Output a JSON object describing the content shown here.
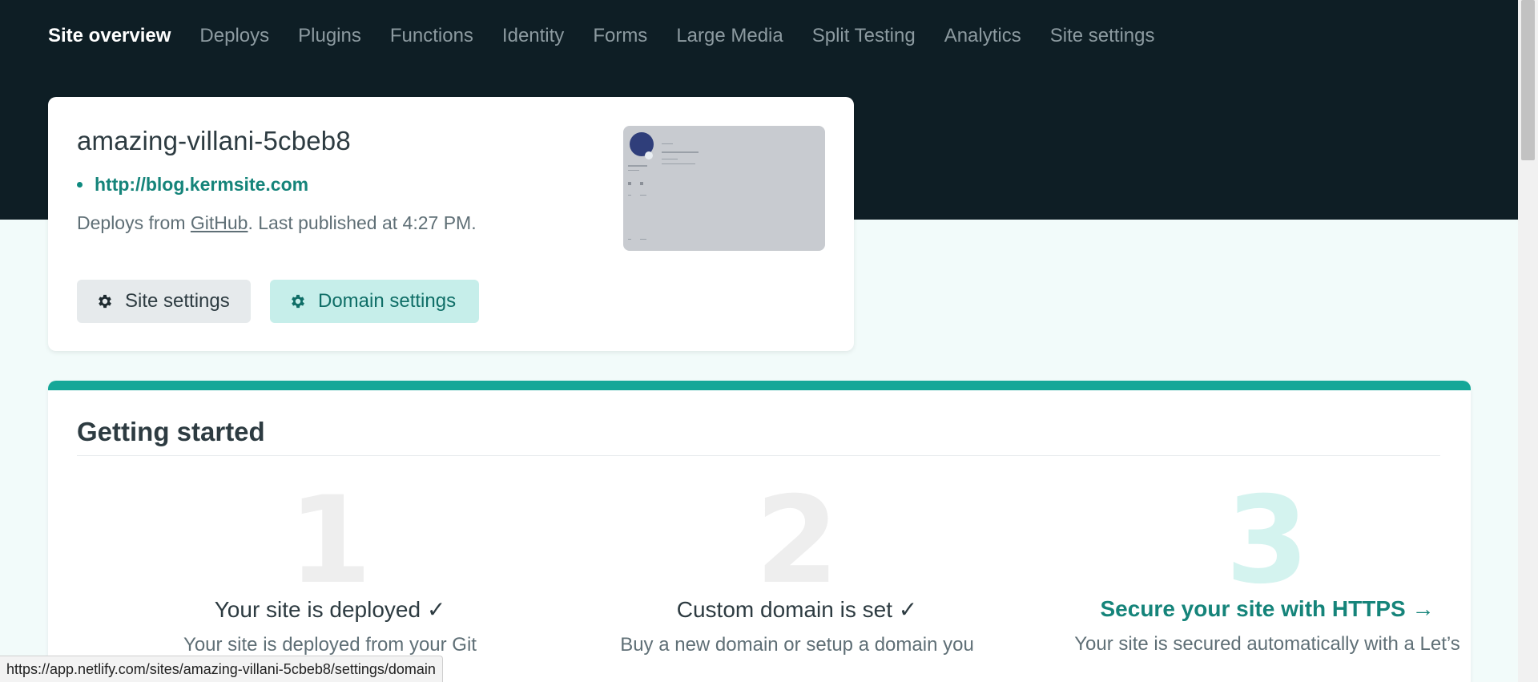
{
  "nav": {
    "items": [
      {
        "label": "Site overview",
        "active": true
      },
      {
        "label": "Deploys"
      },
      {
        "label": "Plugins"
      },
      {
        "label": "Functions"
      },
      {
        "label": "Identity"
      },
      {
        "label": "Forms"
      },
      {
        "label": "Large Media"
      },
      {
        "label": "Split Testing"
      },
      {
        "label": "Analytics"
      },
      {
        "label": "Site settings"
      }
    ]
  },
  "site": {
    "name": "amazing-villani-5cbeb8",
    "url": "http://blog.kermsite.com",
    "deploy_prefix": "Deploys from ",
    "deploy_provider": "GitHub",
    "deploy_suffix": ". Last published at 4:27 PM.",
    "buttons": {
      "site_settings": "Site settings",
      "domain_settings": "Domain settings"
    }
  },
  "getting_started": {
    "title": "Getting started",
    "steps": [
      {
        "number": "1",
        "heading": "Your site is deployed ✓",
        "desc": "Your site is deployed from your Git"
      },
      {
        "number": "2",
        "heading": "Custom domain is set ✓",
        "desc": "Buy a new domain or setup a domain you"
      },
      {
        "number": "3",
        "heading": "Secure your site with HTTPS →",
        "desc": "Your site is secured automatically with a Let’s"
      }
    ]
  },
  "status_bar": {
    "url": "https://app.netlify.com/sites/amazing-villani-5cbeb8/settings/domain"
  },
  "colors": {
    "header_bg": "#0e1e25",
    "accent": "#15a798",
    "link": "#15847a",
    "domain_button_bg": "#c6eeea"
  },
  "icons": {
    "settings": "gear-icon"
  }
}
